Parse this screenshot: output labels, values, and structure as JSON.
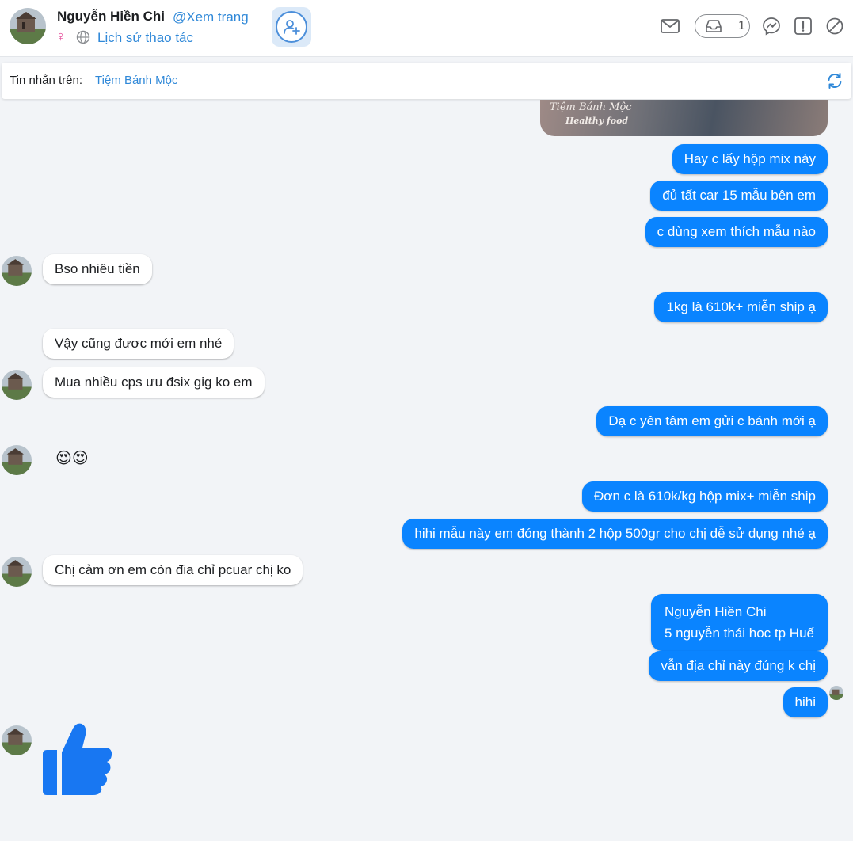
{
  "header": {
    "name": "Nguyễn Hiền Chi",
    "view_page_link": "@Xem trang",
    "gender_symbol": "♀",
    "history_link": "Lịch sử thao tác",
    "inbox_count": "1",
    "icons": [
      "envelope-icon",
      "inbox-icon",
      "messenger-icon",
      "report-icon",
      "block-icon"
    ]
  },
  "infobar": {
    "label": "Tin nhắn trên:",
    "page_name": "Tiệm Bánh Mộc"
  },
  "photo": {
    "caption_line1": "Tiệm Bánh Mộc",
    "caption_line2": "Healthy food"
  },
  "messages": [
    {
      "side": "out",
      "text": "Hay c lấy hộp mix này"
    },
    {
      "side": "out",
      "text": "đủ tất car 15 mẫu bên em"
    },
    {
      "side": "out",
      "text": "c dùng xem thích mẫu nào"
    },
    {
      "side": "in",
      "text": "Bso nhiêu tiền"
    },
    {
      "side": "out",
      "text": "1kg là 610k+ miễn ship ạ"
    },
    {
      "side": "in",
      "text": "Vậy cũng đươc mới em nhé"
    },
    {
      "side": "in",
      "text": "Mua nhiều cps ưu đsix gig ko em"
    },
    {
      "side": "out",
      "text": "Dạ c yên tâm em gửi c bánh mới ạ"
    },
    {
      "side": "in",
      "text": "😍😍"
    },
    {
      "side": "out",
      "text": "Đơn c là 610k/kg hộp mix+ miễn ship"
    },
    {
      "side": "out",
      "text": "hihi mẫu này em đóng thành 2 hộp 500gr cho chị dễ sử dụng nhé ạ"
    },
    {
      "side": "in",
      "text": "Chị cảm ơn em còn đia chỉ pcuar chị ko"
    },
    {
      "side": "out",
      "text": "Nguyễn Hiền Chi"
    },
    {
      "side": "out",
      "text": "5 nguyễn thái hoc tp Huế"
    },
    {
      "side": "out",
      "text": "vẫn địa chỉ này đúng k chị"
    },
    {
      "side": "out",
      "text": "hihi"
    }
  ],
  "colors": {
    "outgoing_bubble": "#0a84ff",
    "incoming_bubble": "#ffffff",
    "link": "#2f88d8",
    "background": "#f2f4f7",
    "like": "#1877f2"
  }
}
